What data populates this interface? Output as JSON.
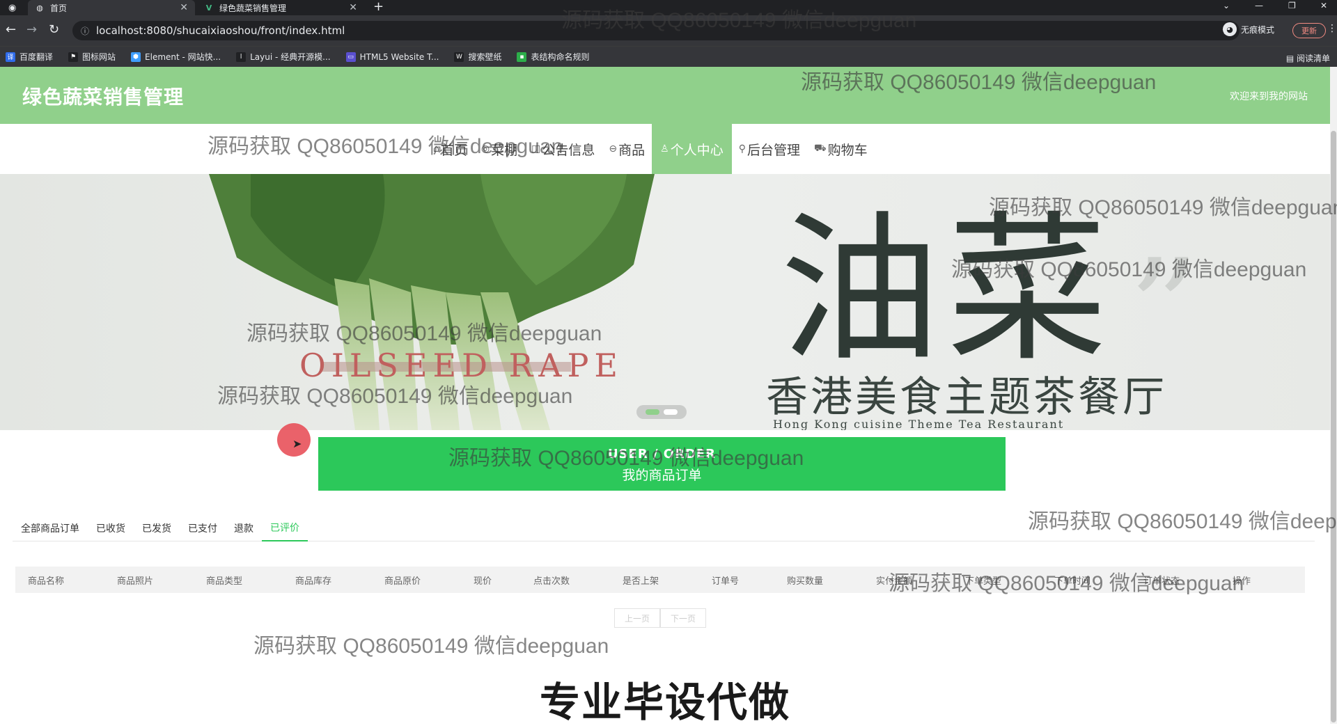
{
  "browser": {
    "tabs": [
      {
        "title": "首页",
        "favicon": "globe-icon"
      },
      {
        "title": "绿色蔬菜销售管理",
        "favicon": "vue-icon"
      }
    ],
    "url": "localhost:8080/shucaixiaoshou/front/index.html",
    "incognito_label": "无痕模式",
    "update_label": "更新",
    "reading_list": "阅读清单",
    "bookmarks": [
      {
        "label": "百度翻译",
        "color": "#2f6bea",
        "glyph": "译"
      },
      {
        "label": "图标网站",
        "color": "#202124",
        "glyph": "⚑"
      },
      {
        "label": "Element - 网站快...",
        "color": "#409eff",
        "glyph": "⬢"
      },
      {
        "label": "Layui - 经典开源模...",
        "color": "#202124",
        "glyph": "l"
      },
      {
        "label": "HTML5 Website T...",
        "color": "#5a4fcf",
        "glyph": "▭"
      },
      {
        "label": "搜索壁纸",
        "color": "#202124",
        "glyph": "W"
      },
      {
        "label": "表结构命名规则",
        "color": "#2cae4a",
        "glyph": "▪"
      }
    ]
  },
  "site": {
    "title": "绿色蔬菜销售管理",
    "welcome": "欢迎来到我的网站",
    "nav": [
      {
        "label": "首页",
        "icon": "home-icon",
        "glyph": "⌂",
        "active": false
      },
      {
        "label": "菜棚",
        "icon": "tent-icon",
        "glyph": "◎",
        "active": false
      },
      {
        "label": "公告信息",
        "icon": "notice-icon",
        "glyph": "◫",
        "active": false
      },
      {
        "label": "商品",
        "icon": "goods-icon",
        "glyph": "⊖",
        "active": false
      },
      {
        "label": "个人中心",
        "icon": "user-icon",
        "glyph": "♙",
        "active": true
      },
      {
        "label": "后台管理",
        "icon": "link-icon",
        "glyph": "⚲",
        "active": false
      },
      {
        "label": "购物车",
        "icon": "cart-icon",
        "glyph": "⛟",
        "active": false
      }
    ]
  },
  "banner": {
    "big_text": "油菜",
    "sub_text": "香港美食主题茶餐厅",
    "en_text": "OILSEED RAPE",
    "small_text": "Hong Kong cuisine Theme Tea Restaurant"
  },
  "section": {
    "title_en": "USER / ORDER",
    "title_cn": "我的商品订单"
  },
  "order_tabs": [
    "全部商品订单",
    "已收货",
    "已发货",
    "已支付",
    "退款",
    "已评价"
  ],
  "active_tab_index": 5,
  "table_headers": [
    "商品名称",
    "商品照片",
    "商品类型",
    "商品库存",
    "商品原价",
    "现价",
    "点击次数",
    "是否上架",
    "订单号",
    "购买数量",
    "实付金额",
    "下单类型",
    "下单时间",
    "订单状态",
    "操作"
  ],
  "pager": {
    "prev": "上一页",
    "next": "下一页"
  },
  "watermark": "源码获取 QQ86050149 微信deepguan",
  "caption": "专业毕设代做",
  "colors": {
    "header_green": "#90d08b",
    "button_green": "#2cc85a"
  }
}
